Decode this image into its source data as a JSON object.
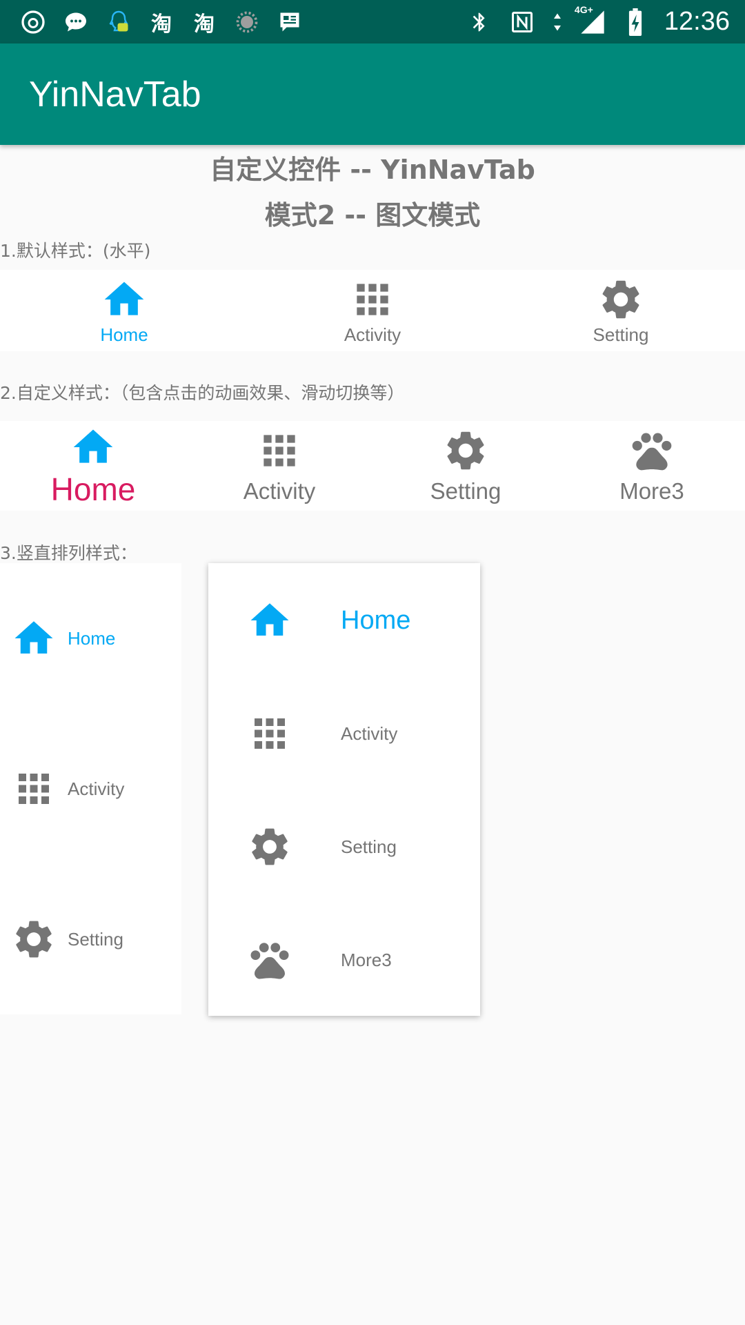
{
  "status_bar": {
    "time": "12:36",
    "network": "4G+",
    "left_icons": [
      "netease-music-icon",
      "message-bubble-icon",
      "qq-icon",
      "taobao-icon",
      "taobao-icon",
      "loading-icon",
      "news-icon"
    ],
    "right_icons": [
      "bluetooth-icon",
      "nfc-icon",
      "data-arrows-icon",
      "signal-icon",
      "battery-icon"
    ]
  },
  "app_bar": {
    "title": "YinNavTab"
  },
  "headings": {
    "title1": "自定义控件 -- YinNavTab",
    "title2": "模式2 -- 图文模式"
  },
  "section1": {
    "label": "1.默认样式：(水平)",
    "tabs": [
      {
        "label": "Home",
        "icon": "home-icon",
        "active": true
      },
      {
        "label": "Activity",
        "icon": "grid-icon",
        "active": false
      },
      {
        "label": "Setting",
        "icon": "gear-icon",
        "active": false
      }
    ]
  },
  "section2": {
    "label": "2.自定义样式：（包含点击的动画效果、滑动切换等）",
    "tabs": [
      {
        "label": "Home",
        "icon": "home-icon",
        "active": true
      },
      {
        "label": "Activity",
        "icon": "grid-icon",
        "active": false
      },
      {
        "label": "Setting",
        "icon": "gear-icon",
        "active": false
      },
      {
        "label": "More3",
        "icon": "paw-icon",
        "active": false
      }
    ]
  },
  "section3": {
    "label": "3.竖直排列样式：",
    "left_tabs": [
      {
        "label": "Home",
        "icon": "home-icon",
        "active": true
      },
      {
        "label": "Activity",
        "icon": "grid-icon",
        "active": false
      },
      {
        "label": "Setting",
        "icon": "gear-icon",
        "active": false
      }
    ],
    "right_tabs": [
      {
        "label": "Home",
        "icon": "home-icon",
        "active": true
      },
      {
        "label": "Activity",
        "icon": "grid-icon",
        "active": false
      },
      {
        "label": "Setting",
        "icon": "gear-icon",
        "active": false
      },
      {
        "label": "More3",
        "icon": "paw-icon",
        "active": false
      }
    ]
  },
  "colors": {
    "status_bar": "#005f55",
    "app_bar": "#00897b",
    "active_blue": "#03a9f4",
    "active_pink": "#d81b60",
    "inactive": "#757575"
  }
}
